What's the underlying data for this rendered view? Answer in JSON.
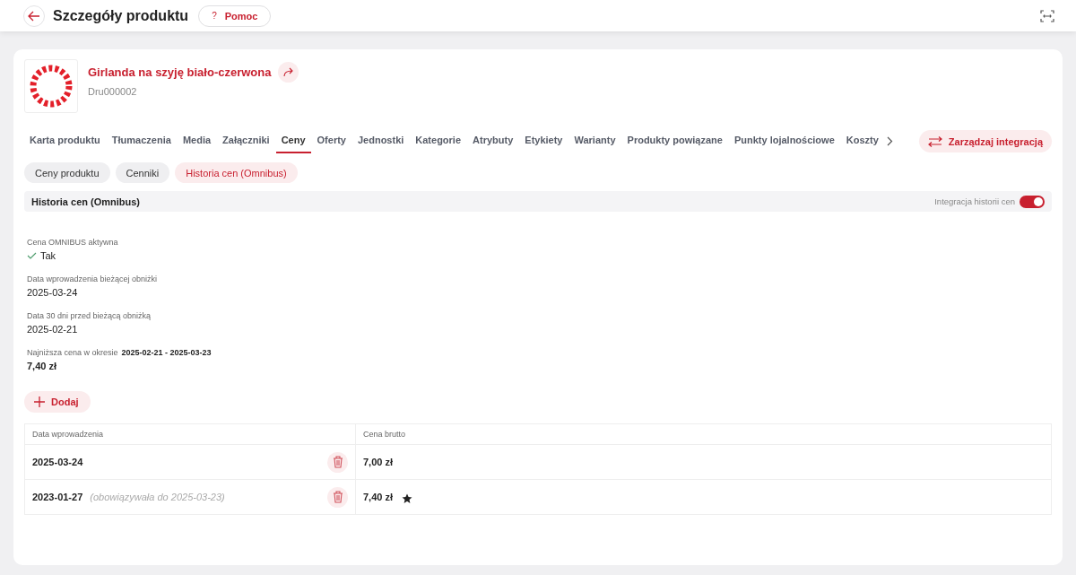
{
  "header": {
    "title": "Szczegóły produktu",
    "help_icon": "?",
    "help": "Pomoc"
  },
  "product": {
    "name": "Girlanda na szyję biało-czerwona",
    "code": "Dru000002"
  },
  "tabs": [
    {
      "label": "Karta produktu",
      "selected": false
    },
    {
      "label": "Tłumaczenia",
      "selected": false
    },
    {
      "label": "Media",
      "selected": false
    },
    {
      "label": "Załączniki",
      "selected": false
    },
    {
      "label": "Ceny",
      "selected": true
    },
    {
      "label": "Oferty",
      "selected": false
    },
    {
      "label": "Jednostki",
      "selected": false
    },
    {
      "label": "Kategorie",
      "selected": false
    },
    {
      "label": "Atrybuty",
      "selected": false
    },
    {
      "label": "Etykiety",
      "selected": false
    },
    {
      "label": "Warianty",
      "selected": false
    },
    {
      "label": "Produkty powiązane",
      "selected": false
    },
    {
      "label": "Punkty lojalnościowe",
      "selected": false
    },
    {
      "label": "Koszty",
      "selected": false
    }
  ],
  "manage_button": "Zarządzaj integracją",
  "subtabs": [
    {
      "label": "Ceny produktu",
      "selected": false
    },
    {
      "label": "Cenniki",
      "selected": false
    },
    {
      "label": "Historia cen (Omnibus)",
      "selected": true
    }
  ],
  "section": {
    "title": "Historia cen (Omnibus)",
    "toggle_label": "Integracja historii cen",
    "toggle_on": true
  },
  "fields": [
    {
      "kind": "check",
      "label": "Cena OMNIBUS aktywna",
      "value": "Tak"
    },
    {
      "kind": "text",
      "label": "Data wprowadzenia bieżącej obniżki",
      "value": "2025-03-24"
    },
    {
      "kind": "text",
      "label": "Data 30 dni przed bieżącą obniżką",
      "value": "2025-02-21"
    },
    {
      "kind": "range",
      "label": "Najniższa cena w okresie",
      "range": "2025-02-21 - 2025-03-23",
      "value": "7,40 zł"
    }
  ],
  "add_button": "Dodaj",
  "table": {
    "columns": [
      "Data wprowadzenia",
      "Cena brutto"
    ],
    "rows": [
      {
        "date": "2025-03-24",
        "price": "7,00 zł",
        "starred": false
      },
      {
        "date": "2023-01-27",
        "note": "(obowiązywała do 2025-03-23)",
        "price": "7,40 zł",
        "starred": true
      }
    ]
  }
}
